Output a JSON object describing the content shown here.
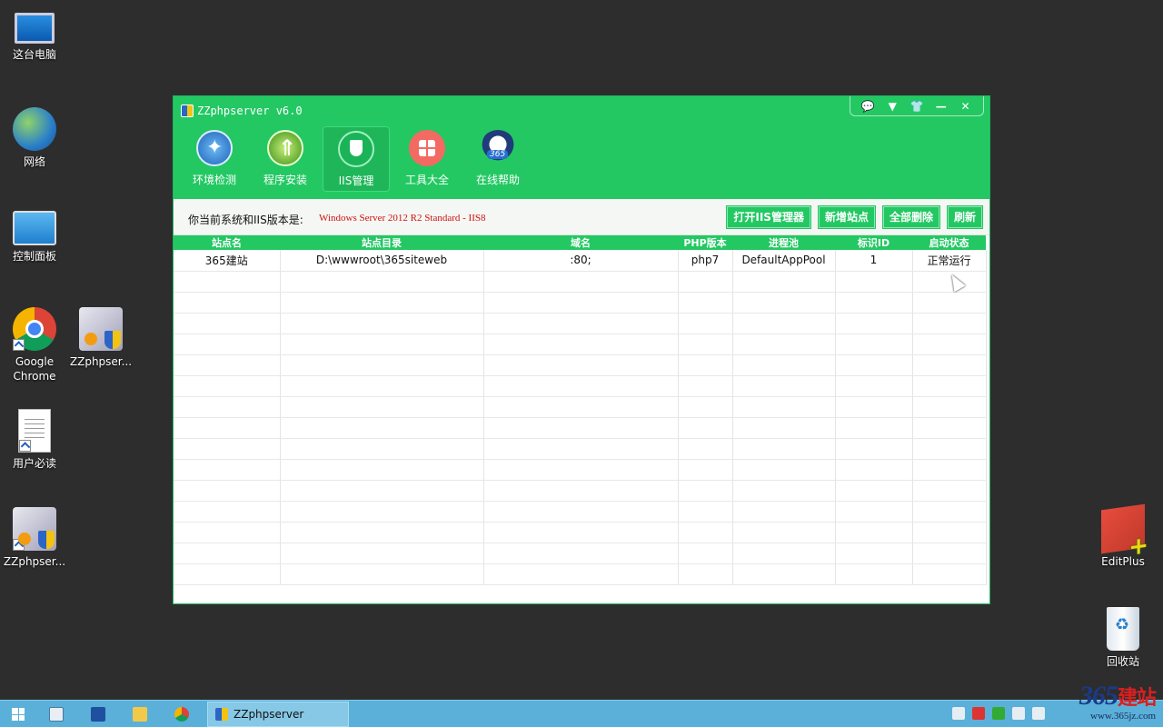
{
  "desktop": {
    "icons": [
      {
        "label": "这台电脑"
      },
      {
        "label": "网络"
      },
      {
        "label": "控制面板"
      },
      {
        "label": "Google Chrome"
      },
      {
        "label": "ZZphpser..."
      },
      {
        "label": "用户必读"
      },
      {
        "label": "ZZphpser..."
      },
      {
        "label": "EditPlus"
      },
      {
        "label": "回收站"
      }
    ]
  },
  "window": {
    "title": "ZZphpserver v6.0",
    "controls": [
      "💬",
      "▼",
      "👕",
      "—",
      "✕"
    ],
    "nav": [
      {
        "label": "环境检测",
        "icon": "shield-scan-icon"
      },
      {
        "label": "程序安装",
        "icon": "install-arrow-icon"
      },
      {
        "label": "IIS管理",
        "icon": "shield-icon",
        "active": true
      },
      {
        "label": "工具大全",
        "icon": "tools-grid-icon"
      },
      {
        "label": "在线帮助",
        "icon": "help-mascot-icon"
      }
    ],
    "info_label": "你当前系统和IIS版本是:",
    "info_value": "Windows Server 2012 R2 Standard - IIS8",
    "buttons": [
      "打开IIS管理器",
      "新增站点",
      "全部删除",
      "刷新"
    ]
  },
  "table": {
    "headers": [
      "站点名",
      "站点目录",
      "域名",
      "PHP版本",
      "进程池",
      "标识ID",
      "启动状态"
    ],
    "rows": [
      [
        "365建站",
        "D:\\wwwroot\\365siteweb",
        ":80;",
        "php7",
        "DefaultAppPool",
        "1",
        "正常运行"
      ]
    ],
    "empty_rows": 15
  },
  "taskbar": {
    "task_label": "ZZphpserver"
  },
  "watermark": {
    "number": "365",
    "cn": "建站",
    "url": "www.365jz.com"
  },
  "colors": {
    "accent": "#23c863",
    "desktop": "#2d2d2d",
    "taskbar": "#5ab0d8",
    "info_value": "#d01010"
  }
}
